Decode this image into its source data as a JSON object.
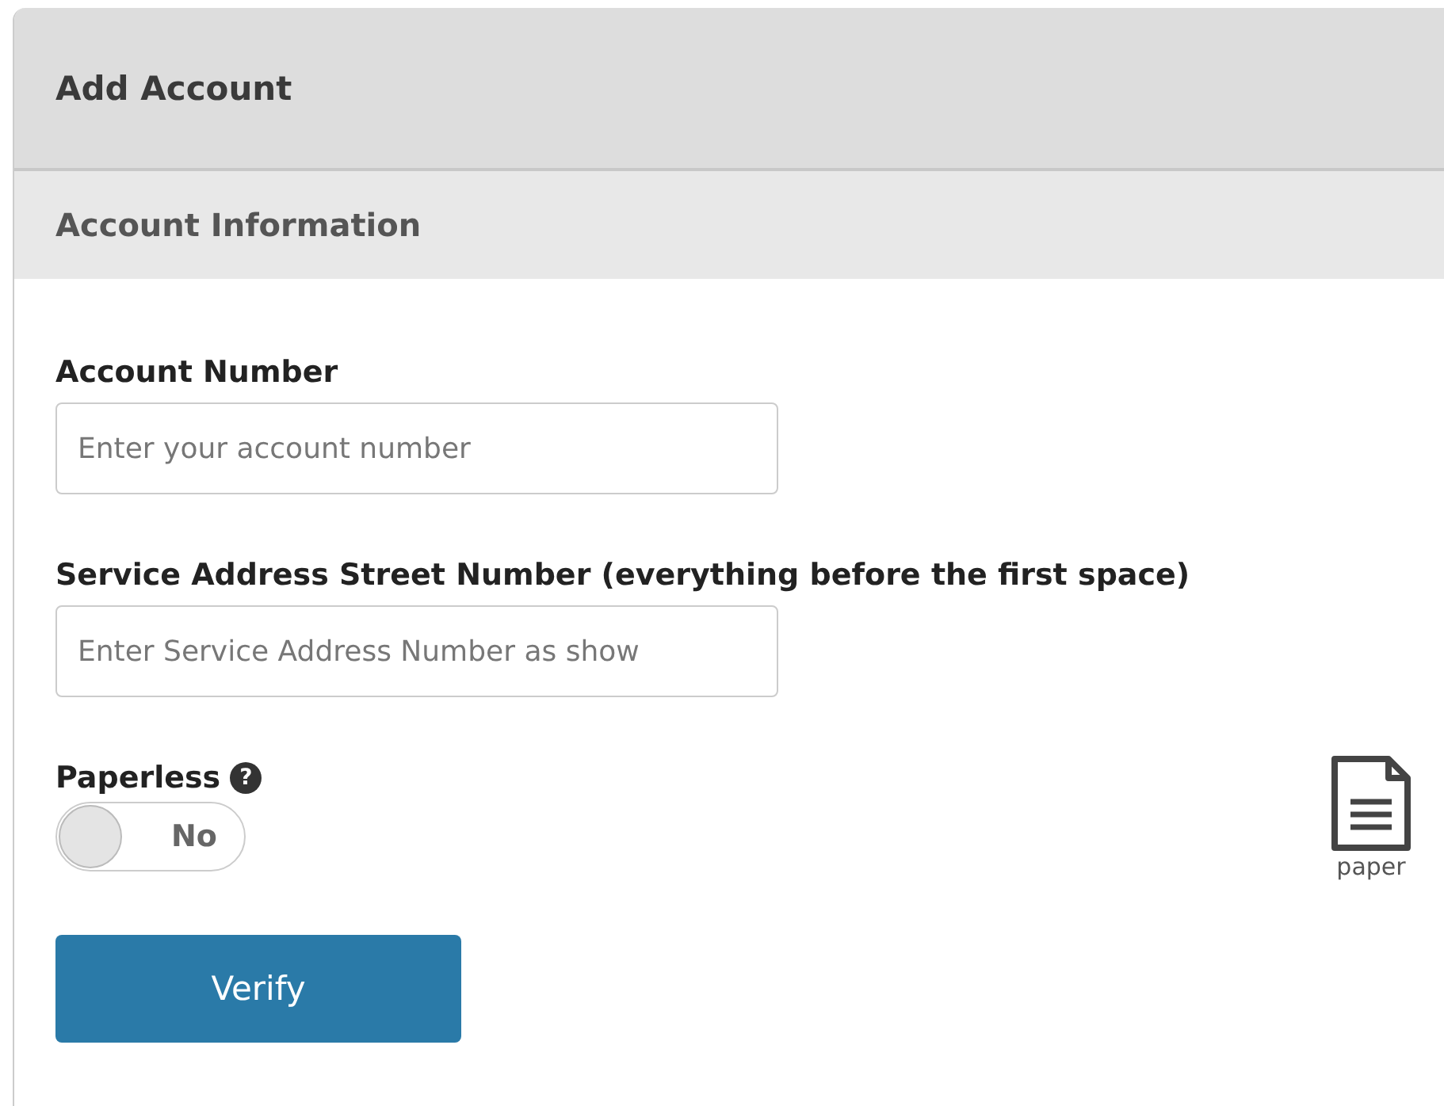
{
  "header": {
    "title": "Add Account"
  },
  "section": {
    "title": "Account Information"
  },
  "fields": [
    {
      "label": "Account Number",
      "placeholder": "Enter your account number"
    },
    {
      "label": "Service Address Street Number (everything before the first space)",
      "placeholder": "Enter Service Address Number as show"
    }
  ],
  "paperless": {
    "label": "Paperless",
    "help": "?",
    "on": false,
    "state_text": "No",
    "icon_caption": "paper"
  },
  "buttons": [
    "Verify"
  ]
}
